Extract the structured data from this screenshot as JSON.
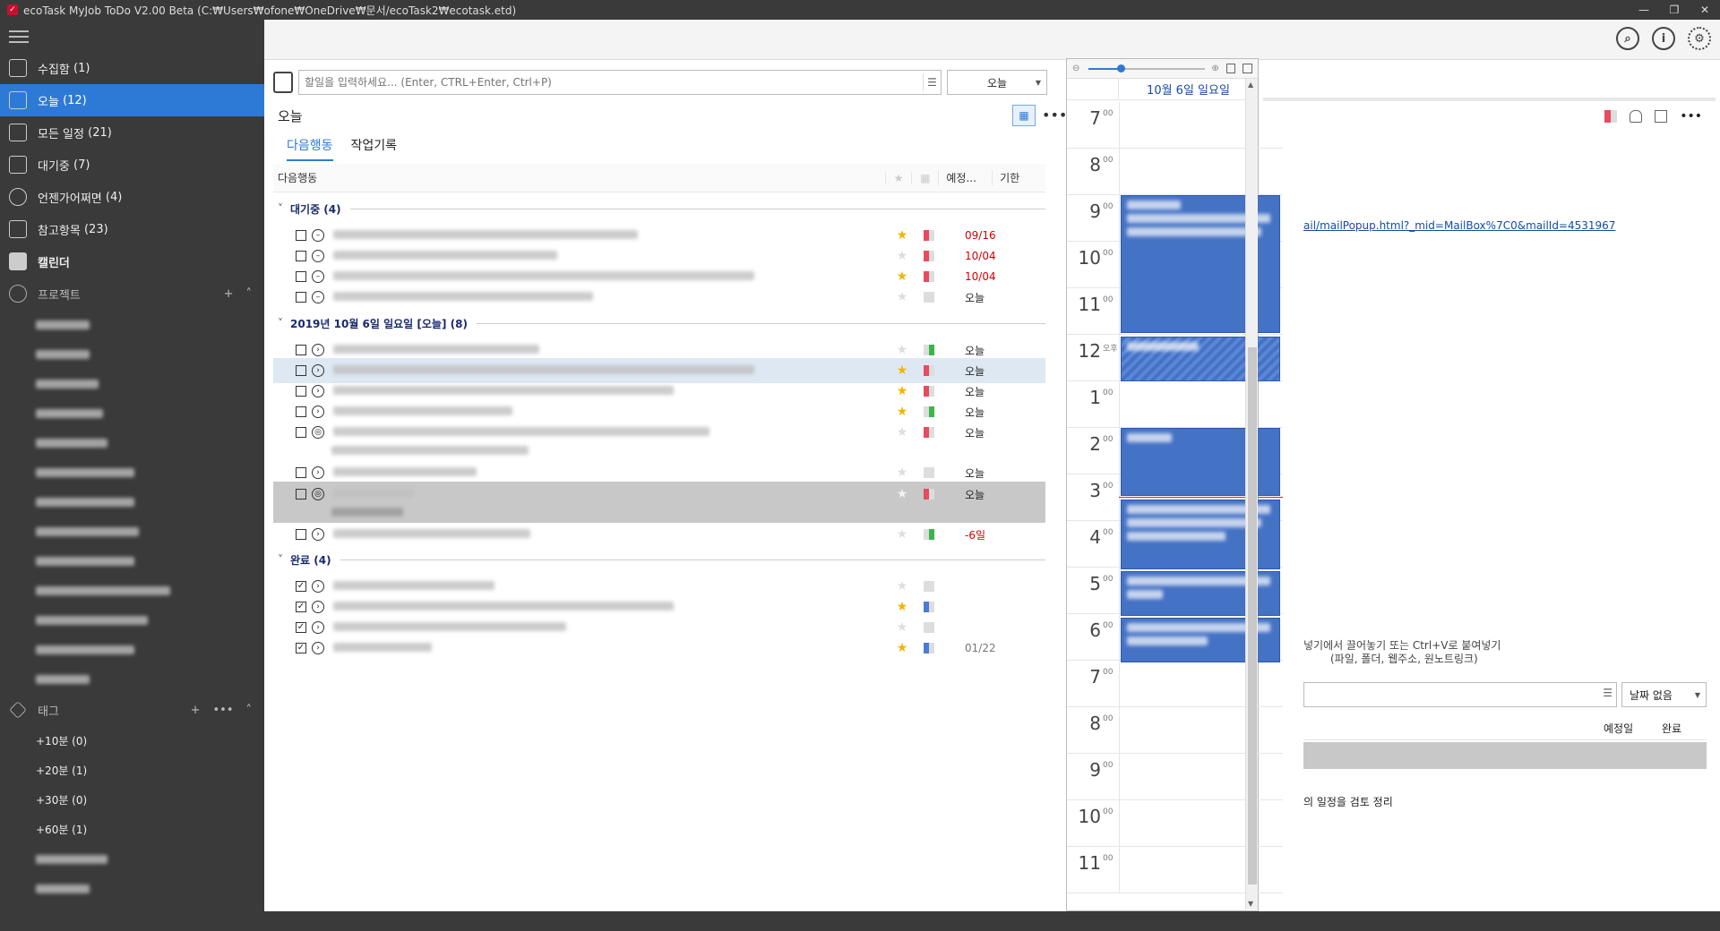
{
  "window": {
    "title": "ecoTask MyJob ToDo V2.00 Beta (C:₩Users₩ofone₩OneDrive₩문서/ecoTask2₩ecotask.etd)",
    "controls": [
      "—",
      "❐",
      "✕"
    ]
  },
  "sidebar": {
    "nav": [
      {
        "label": "수집함",
        "count": "(1)"
      },
      {
        "label": "오늘",
        "count": "(12)"
      },
      {
        "label": "모든 일정",
        "count": "(21)"
      },
      {
        "label": "대기중",
        "count": "(7)"
      },
      {
        "label": "언젠가어쩌면",
        "count": "(4)"
      },
      {
        "label": "참고항목",
        "count": "(23)"
      },
      {
        "label": "캘린더",
        "count": ""
      }
    ],
    "projects_label": "프로젝트",
    "tags_label": "태그",
    "tags": [
      "+10분 (0)",
      "+20분 (1)",
      "+30분 (0)",
      "+60분 (1)"
    ]
  },
  "toolbar": {
    "search_icon": "search-icon",
    "info_icon": "info-icon",
    "settings_icon": "gear-icon"
  },
  "tasks": {
    "input_placeholder": "할일을 입력하세요... (Enter, CTRL+Enter, Ctrl+P)",
    "date_filter": "오늘",
    "panel_title": "오늘",
    "tabs": [
      "다음행동",
      "작업기록"
    ],
    "columns": {
      "name": "다음행동",
      "scheduled": "예정...",
      "due": "기한"
    },
    "groups": [
      {
        "label": "대기중 (4)"
      },
      {
        "label": "2019년 10월 6일 일요일 [오늘] (8)"
      },
      {
        "label": "완료 (4)"
      }
    ],
    "due_values": {
      "w1": "09/16",
      "w2": "10/04",
      "w3": "10/04",
      "w4": "오늘",
      "t1": "오늘",
      "t2": "오늘",
      "t3": "오늘",
      "t4": "오늘",
      "t5": "오늘",
      "t6": "오늘",
      "t7": "오늘",
      "t8": "-6일",
      "d4": "01/22"
    }
  },
  "calendar": {
    "date_label": "10월 6일 일요일",
    "hours": [
      {
        "h": "7",
        "m": "00"
      },
      {
        "h": "8",
        "m": "00"
      },
      {
        "h": "9",
        "m": "00"
      },
      {
        "h": "10",
        "m": "00"
      },
      {
        "h": "11",
        "m": "00"
      },
      {
        "h": "12",
        "m": "오후"
      },
      {
        "h": "1",
        "m": "00"
      },
      {
        "h": "2",
        "m": "00"
      },
      {
        "h": "3",
        "m": "00"
      },
      {
        "h": "4",
        "m": "00"
      },
      {
        "h": "5",
        "m": "00"
      },
      {
        "h": "6",
        "m": "00"
      },
      {
        "h": "7",
        "m": "00"
      },
      {
        "h": "8",
        "m": "00"
      },
      {
        "h": "9",
        "m": "00"
      },
      {
        "h": "10",
        "m": "00"
      },
      {
        "h": "11",
        "m": "00"
      }
    ]
  },
  "detail": {
    "link": "ail/mailPopup.html?_mid=MailBox%7C0&mailId=4531967",
    "hint_line1": "넣기에서 끌어놓기 또는 Ctrl+V로 붙여넣기",
    "hint_line2": "(파일, 폴더, 웹주소, 원노트링크)",
    "no_date": "날짜 없음",
    "col_scheduled": "예정일",
    "col_done": "완료",
    "review_text": "의 일정을 검토 정리"
  },
  "colors": {
    "accent": "#2d7ad6",
    "sidebar_bg": "#3a3a3a",
    "event_blue": "#4472c4",
    "due_red": "#d40000",
    "star": "#f2b400"
  }
}
